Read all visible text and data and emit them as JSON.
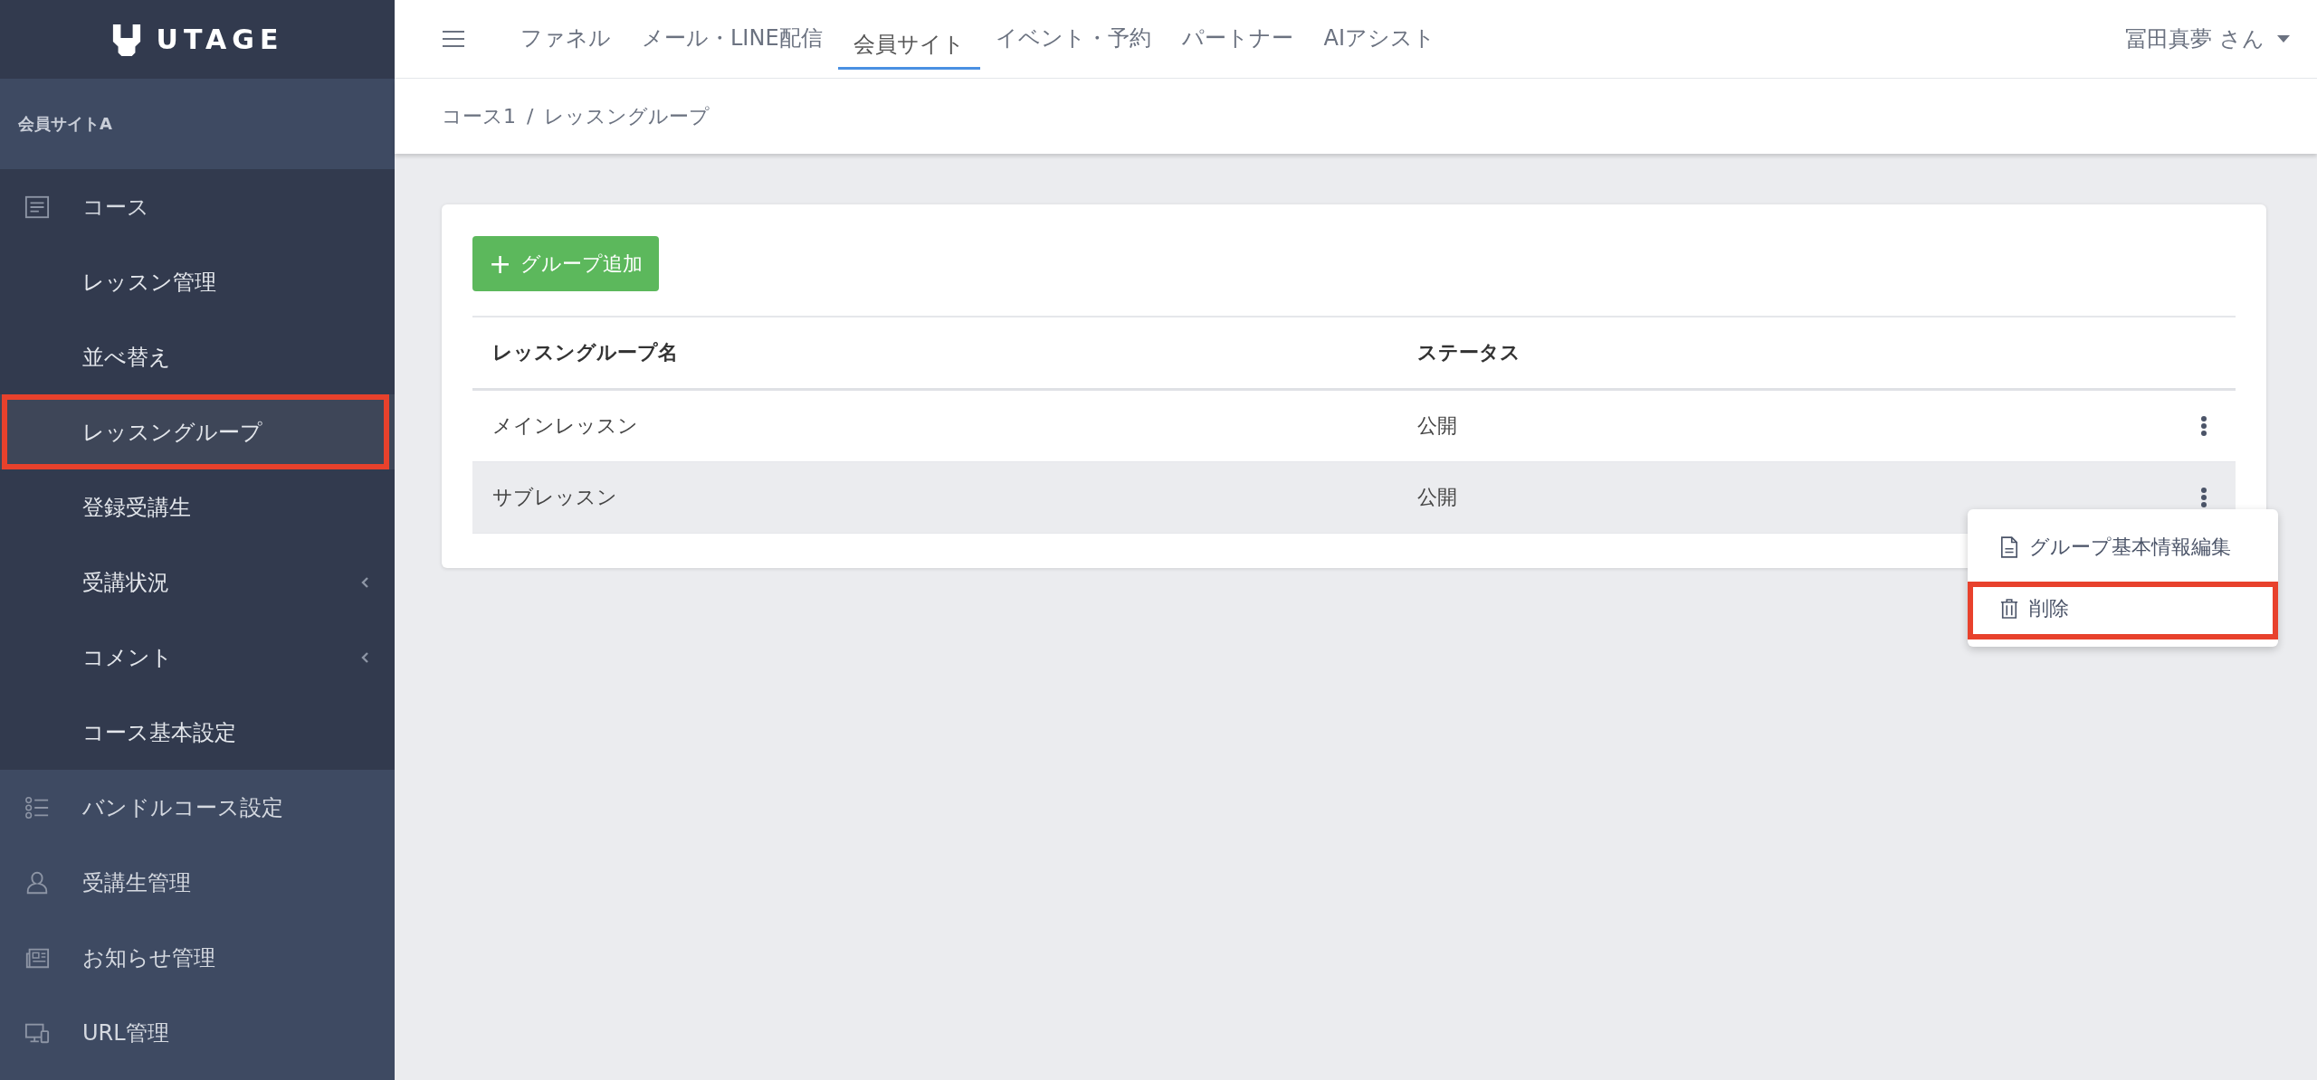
{
  "logo": {
    "text": "UTAGE"
  },
  "sidebar": {
    "section": "会員サイトA",
    "items": [
      {
        "label": "コース",
        "expanded": true,
        "children": [
          {
            "label": "レッスン管理",
            "selected": false,
            "highlighted": false,
            "has_submenu": false
          },
          {
            "label": "並べ替え",
            "selected": false,
            "highlighted": false,
            "has_submenu": false
          },
          {
            "label": "レッスングループ",
            "selected": true,
            "highlighted": true,
            "has_submenu": false
          },
          {
            "label": "登録受講生",
            "selected": false,
            "highlighted": false,
            "has_submenu": false
          },
          {
            "label": "受講状況",
            "selected": false,
            "highlighted": false,
            "has_submenu": true
          },
          {
            "label": "コメント",
            "selected": false,
            "highlighted": false,
            "has_submenu": true
          },
          {
            "label": "コース基本設定",
            "selected": false,
            "highlighted": false,
            "has_submenu": false
          }
        ]
      },
      {
        "label": "バンドルコース設定",
        "expanded": false
      },
      {
        "label": "受講生管理",
        "expanded": false
      },
      {
        "label": "お知らせ管理",
        "expanded": false
      },
      {
        "label": "URL管理",
        "expanded": false
      }
    ]
  },
  "tabs": [
    {
      "label": "ファネル",
      "selected": false
    },
    {
      "label": "メール・LINE配信",
      "selected": false
    },
    {
      "label": "会員サイト",
      "selected": true
    },
    {
      "label": "イベント・予約",
      "selected": false
    },
    {
      "label": "パートナー",
      "selected": false
    },
    {
      "label": "AIアシスト",
      "selected": false
    }
  ],
  "user": {
    "name": "冨田真夢 さん"
  },
  "breadcrumb": [
    "コース1",
    "/",
    "レッスングループ"
  ],
  "add_button": {
    "icon": "+",
    "label": "グループ追加"
  },
  "table": {
    "columns": [
      "レッスングループ名",
      "ステータス"
    ],
    "rows": [
      {
        "name": "メインレッスン",
        "status": "公開",
        "active": false
      },
      {
        "name": "サブレッスン",
        "status": "公開",
        "active": true
      }
    ]
  },
  "menu": {
    "items": [
      {
        "label": "グループ基本情報編集",
        "highlighted": false
      },
      {
        "label": "削除",
        "highlighted": true
      }
    ]
  }
}
